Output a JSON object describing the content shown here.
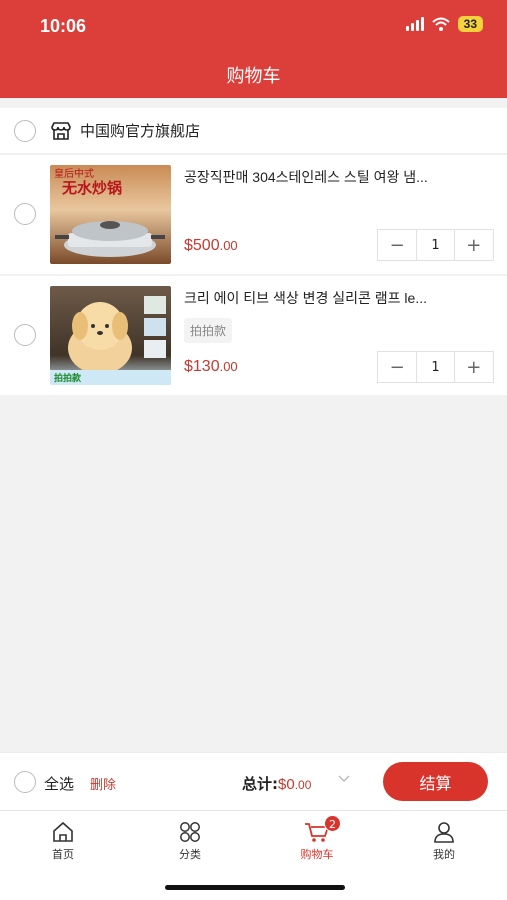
{
  "status": {
    "time": "10:06",
    "battery": "33"
  },
  "header": {
    "title": "购物车"
  },
  "shop": {
    "name": "中国购官方旗舰店"
  },
  "items": [
    {
      "title": "공장직판매 304스테인레스 스틸 여왕 냄...",
      "tag": "",
      "price_main": "$500",
      "price_decimal": ".00",
      "quantity": "1",
      "image_text_1": "皇后中式",
      "image_text_2": "无水炒锅"
    },
    {
      "title": "크리 에이 티브 색상 변경 실리콘 램프 le...",
      "tag": "拍拍款",
      "price_main": "$130",
      "price_decimal": ".00",
      "quantity": "1",
      "image_text_1": "拍拍款"
    }
  ],
  "footer": {
    "select_all": "全选",
    "delete": "删除",
    "total_label": "总计:",
    "total_main": "$0",
    "total_decimal": ".00",
    "checkout": "结算"
  },
  "tabs": [
    {
      "label": "首页",
      "icon": "home-icon"
    },
    {
      "label": "分类",
      "icon": "category-icon"
    },
    {
      "label": "购物车",
      "icon": "cart-icon",
      "badge": "2",
      "active": true
    },
    {
      "label": "我的",
      "icon": "profile-icon"
    }
  ],
  "colors": {
    "brand": "#dc3f3a",
    "price": "#c43a2f",
    "checkout": "#d9342b"
  }
}
